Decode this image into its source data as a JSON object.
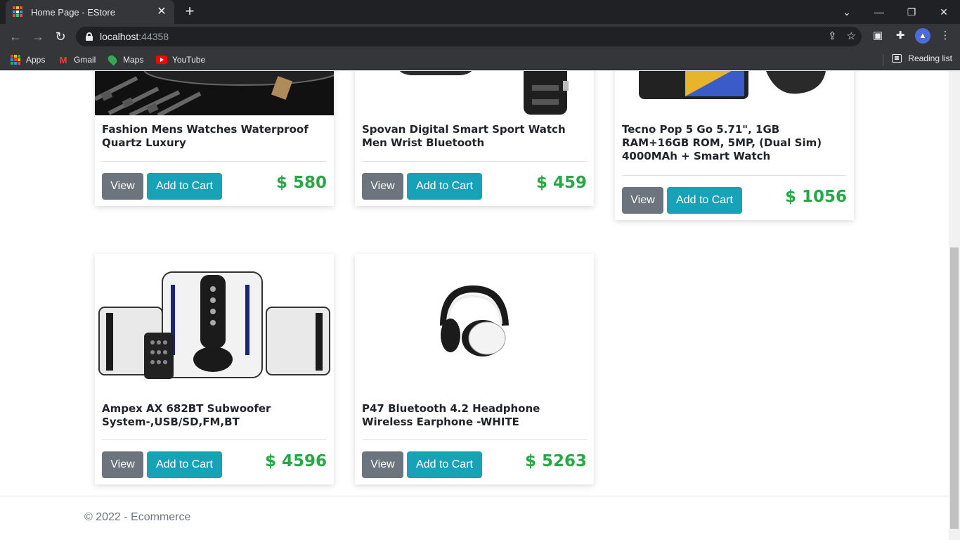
{
  "browser": {
    "tab_title": "Home Page - EStore",
    "url_host": "localhost",
    "url_port": ":44358",
    "bookmarks": [
      {
        "label": "Apps",
        "icon": "apps-grid-icon"
      },
      {
        "label": "Gmail",
        "icon": "gmail-icon"
      },
      {
        "label": "Maps",
        "icon": "maps-icon"
      },
      {
        "label": "YouTube",
        "icon": "youtube-icon"
      }
    ],
    "reading_list": "Reading list"
  },
  "products": [
    {
      "title": "Fashion Mens Watches Waterproof Quartz Luxury",
      "price": "$ 580",
      "view_label": "View",
      "cart_label": "Add to Cart",
      "image": "watch-image"
    },
    {
      "title": "Spovan Digital Smart Sport Watch Men Wrist Bluetooth",
      "price": "$ 459",
      "view_label": "View",
      "cart_label": "Add to Cart",
      "image": "smartwatch-image"
    },
    {
      "title": "Tecno Pop 5 Go 5.71\", 1GB RAM+16GB ROM, 5MP, (Dual Sim) 4000MAh + Smart Watch",
      "price": "$ 1056",
      "view_label": "View",
      "cart_label": "Add to Cart",
      "image": "phone-watch-image"
    },
    {
      "title": "Ampex AX 682BT Subwoofer System-,USB/SD,FM,BT",
      "price": "$ 4596",
      "view_label": "View",
      "cart_label": "Add to Cart",
      "image": "subwoofer-image"
    },
    {
      "title": "P47 Bluetooth 4.2 Headphone Wireless Earphone -WHITE",
      "price": "$ 5263",
      "view_label": "View",
      "cart_label": "Add to Cart",
      "image": "headphone-image"
    }
  ],
  "footer": {
    "text": "© 2022 - Ecommerce"
  },
  "colors": {
    "price": "#28a745",
    "view_button": "#6c757d",
    "cart_button": "#17a2b8"
  }
}
